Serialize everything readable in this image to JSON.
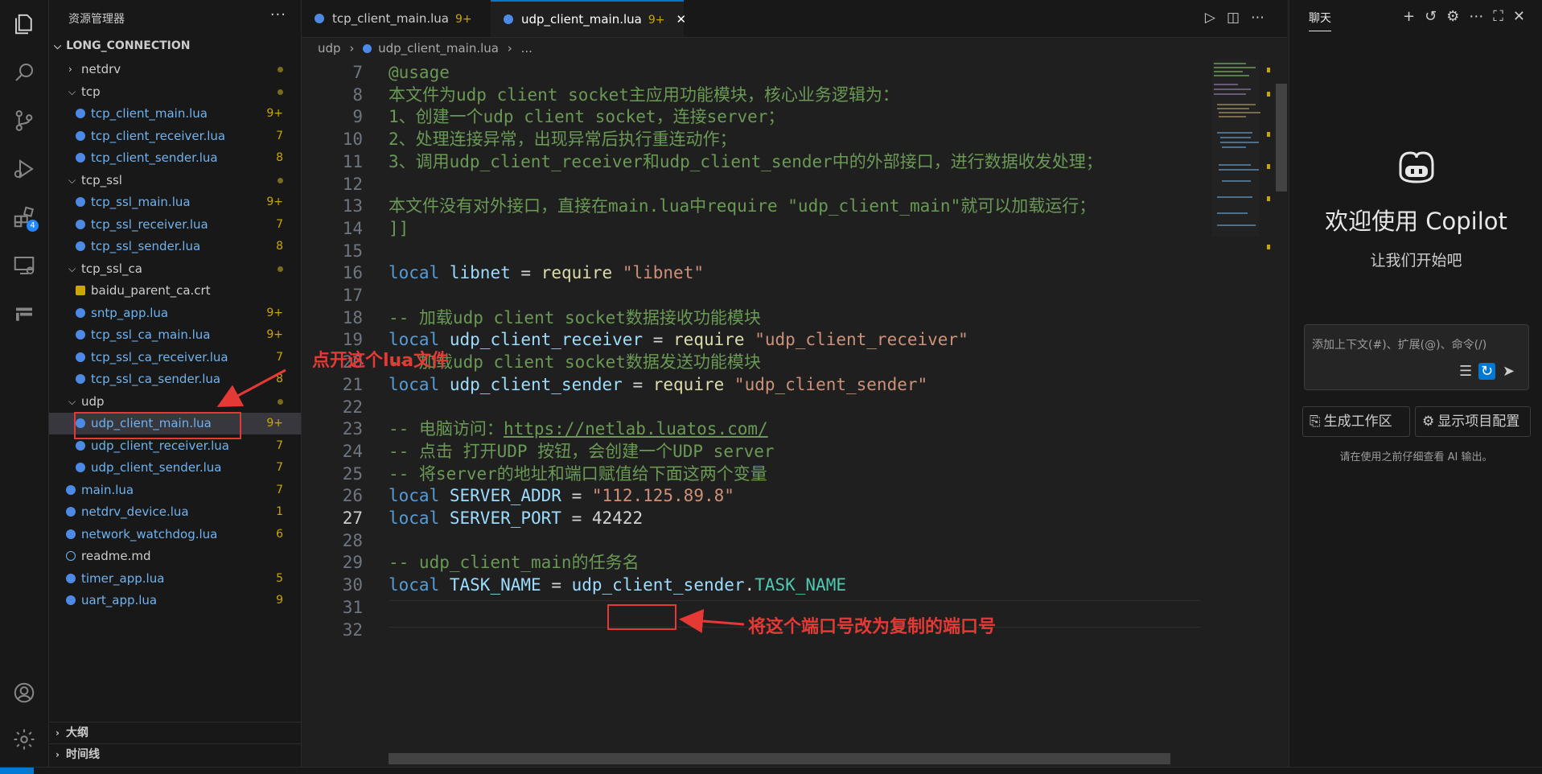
{
  "explorer": {
    "title": "资源管理器",
    "more": "···",
    "root": "LONG_CONNECTION",
    "items": [
      {
        "type": "folder",
        "name": "netdrv",
        "depth": 1,
        "open": false
      },
      {
        "type": "folder",
        "name": "tcp",
        "depth": 1,
        "open": true
      },
      {
        "type": "file",
        "name": "tcp_client_main.lua",
        "depth": 2,
        "status": "9+"
      },
      {
        "type": "file",
        "name": "tcp_client_receiver.lua",
        "depth": 2,
        "status": "7"
      },
      {
        "type": "file",
        "name": "tcp_client_sender.lua",
        "depth": 2,
        "status": "8"
      },
      {
        "type": "folder",
        "name": "tcp_ssl",
        "depth": 1,
        "open": true
      },
      {
        "type": "file",
        "name": "tcp_ssl_main.lua",
        "depth": 2,
        "status": "9+"
      },
      {
        "type": "file",
        "name": "tcp_ssl_receiver.lua",
        "depth": 2,
        "status": "7"
      },
      {
        "type": "file",
        "name": "tcp_ssl_sender.lua",
        "depth": 2,
        "status": "8"
      },
      {
        "type": "folder",
        "name": "tcp_ssl_ca",
        "depth": 1,
        "open": true
      },
      {
        "type": "cert",
        "name": "baidu_parent_ca.crt",
        "depth": 2,
        "status": ""
      },
      {
        "type": "file",
        "name": "sntp_app.lua",
        "depth": 2,
        "status": "9+"
      },
      {
        "type": "file",
        "name": "tcp_ssl_ca_main.lua",
        "depth": 2,
        "status": "9+"
      },
      {
        "type": "file",
        "name": "tcp_ssl_ca_receiver.lua",
        "depth": 2,
        "status": "7"
      },
      {
        "type": "file",
        "name": "tcp_ssl_ca_sender.lua",
        "depth": 2,
        "status": "8"
      },
      {
        "type": "folder",
        "name": "udp",
        "depth": 1,
        "open": true
      },
      {
        "type": "file",
        "name": "udp_client_main.lua",
        "depth": 2,
        "status": "9+",
        "selected": true
      },
      {
        "type": "file",
        "name": "udp_client_receiver.lua",
        "depth": 2,
        "status": "7"
      },
      {
        "type": "file",
        "name": "udp_client_sender.lua",
        "depth": 2,
        "status": "7"
      },
      {
        "type": "file",
        "name": "main.lua",
        "depth": 1,
        "status": "7"
      },
      {
        "type": "file",
        "name": "netdrv_device.lua",
        "depth": 1,
        "status": "1"
      },
      {
        "type": "file",
        "name": "network_watchdog.lua",
        "depth": 1,
        "status": "6"
      },
      {
        "type": "info",
        "name": "readme.md",
        "depth": 1,
        "status": ""
      },
      {
        "type": "file",
        "name": "timer_app.lua",
        "depth": 1,
        "status": "5"
      },
      {
        "type": "file",
        "name": "uart_app.lua",
        "depth": 1,
        "status": "9"
      }
    ],
    "outline": "大纲",
    "timeline": "时间线"
  },
  "tabs": [
    {
      "label": "tcp_client_main.lua",
      "modified": "9+"
    },
    {
      "label": "udp_client_main.lua",
      "modified": "9+",
      "close": "✕"
    }
  ],
  "breadcrumb": {
    "folder": "udp",
    "file": "udp_client_main.lua",
    "rest": "..."
  },
  "activity": {
    "extensions_badge": "4"
  },
  "code": {
    "lines": [
      {
        "n": "7",
        "parts": [
          [
            "cm",
            "@usage"
          ]
        ]
      },
      {
        "n": "8",
        "parts": [
          [
            "cm",
            "本文件为udp client socket主应用功能模块，核心业务逻辑为："
          ]
        ]
      },
      {
        "n": "9",
        "parts": [
          [
            "cm",
            "1、创建一个udp client socket，连接server；"
          ]
        ]
      },
      {
        "n": "10",
        "parts": [
          [
            "cm",
            "2、处理连接异常，出现异常后执行重连动作；"
          ]
        ]
      },
      {
        "n": "11",
        "parts": [
          [
            "cm",
            "3、调用udp_client_receiver和udp_client_sender中的外部接口，进行数据收发处理；"
          ]
        ]
      },
      {
        "n": "12",
        "parts": []
      },
      {
        "n": "13",
        "parts": [
          [
            "cm",
            "本文件没有对外接口，直接在main.lua中require \"udp_client_main\"就可以加载运行；"
          ]
        ]
      },
      {
        "n": "14",
        "parts": [
          [
            "cm",
            "]]"
          ]
        ]
      },
      {
        "n": "15",
        "parts": []
      },
      {
        "n": "16",
        "parts": [
          [
            "kw",
            "local"
          ],
          [
            "op",
            " "
          ],
          [
            "vr",
            "libnet"
          ],
          [
            "op",
            " = "
          ],
          [
            "fn",
            "require"
          ],
          [
            "op",
            " "
          ],
          [
            "st",
            "\"libnet\""
          ]
        ]
      },
      {
        "n": "17",
        "parts": []
      },
      {
        "n": "18",
        "parts": [
          [
            "cm",
            "-- 加载udp client socket数据接收功能模块"
          ]
        ]
      },
      {
        "n": "19",
        "parts": [
          [
            "kw",
            "local"
          ],
          [
            "op",
            " "
          ],
          [
            "vr",
            "udp_client_receiver"
          ],
          [
            "op",
            " = "
          ],
          [
            "fn",
            "require"
          ],
          [
            "op",
            " "
          ],
          [
            "st",
            "\"udp_client_receiver\""
          ]
        ]
      },
      {
        "n": "20",
        "parts": [
          [
            "cm",
            "-- 加载udp client socket数据发送功能模块"
          ]
        ]
      },
      {
        "n": "21",
        "parts": [
          [
            "kw",
            "local"
          ],
          [
            "op",
            " "
          ],
          [
            "vr",
            "udp_client_sender"
          ],
          [
            "op",
            " = "
          ],
          [
            "fn",
            "require"
          ],
          [
            "op",
            " "
          ],
          [
            "st",
            "\"udp_client_sender\""
          ]
        ]
      },
      {
        "n": "22",
        "parts": []
      },
      {
        "n": "23",
        "parts": [
          [
            "cm",
            "-- 电脑访问："
          ],
          [
            "link",
            "https://netlab.luatos.com/"
          ]
        ]
      },
      {
        "n": "24",
        "parts": [
          [
            "cm",
            "-- 点击 打开UDP 按钮，会创建一个UDP server"
          ]
        ]
      },
      {
        "n": "25",
        "parts": [
          [
            "cm",
            "-- 将server的地址和端口赋值给下面这两个变量"
          ]
        ]
      },
      {
        "n": "26",
        "parts": [
          [
            "kw",
            "local"
          ],
          [
            "op",
            " "
          ],
          [
            "vr",
            "SERVER_ADDR"
          ],
          [
            "op",
            " = "
          ],
          [
            "st",
            "\"112.125.89.8\""
          ]
        ]
      },
      {
        "n": "27",
        "parts": [
          [
            "kw",
            "local"
          ],
          [
            "op",
            " "
          ],
          [
            "vr",
            "SERVER_PORT"
          ],
          [
            "op",
            " = "
          ],
          [
            "op",
            "42422"
          ]
        ],
        "current": true
      },
      {
        "n": "28",
        "parts": []
      },
      {
        "n": "29",
        "parts": [
          [
            "cm",
            "-- udp_client_main的任务名"
          ]
        ]
      },
      {
        "n": "30",
        "parts": [
          [
            "kw",
            "local"
          ],
          [
            "op",
            " "
          ],
          [
            "vr",
            "TASK_NAME"
          ],
          [
            "op",
            " = "
          ],
          [
            "vr",
            "udp_client_sender"
          ],
          [
            "op",
            "."
          ],
          [
            "pr",
            "TASK_NAME"
          ]
        ]
      },
      {
        "n": "31",
        "parts": []
      },
      {
        "n": "32",
        "parts": []
      }
    ]
  },
  "chat": {
    "tab": "聊天",
    "welcome": "欢迎使用 Copilot",
    "subtitle": "让我们开始吧",
    "input_placeholder": "添加上下文(#)、扩展(@)、命令(/)",
    "btn_workspace": "生成工作区",
    "btn_config": "显示项目配置",
    "disclaimer": "请在使用之前仔细查看 AI 输出。"
  },
  "annotations": {
    "open_file": "点开这个lua文件",
    "change_port": "将这个端口号改为复制的端口号"
  },
  "colors": {
    "accent": "#0078d4",
    "annotation": "#e53935",
    "comment": "#6a9955",
    "keyword": "#569cd6",
    "string": "#ce9178",
    "warning": "#cca700"
  }
}
